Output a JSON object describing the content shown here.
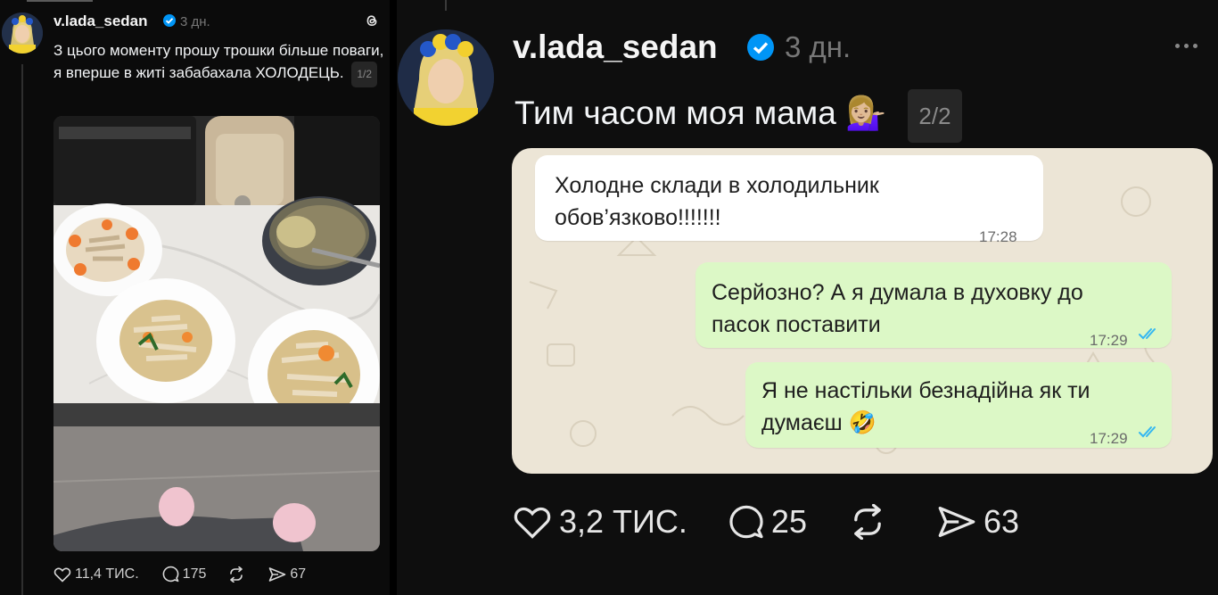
{
  "left_post": {
    "username": "v.lada_sedan",
    "time": "3 дн.",
    "text": "З цього моменту прошу трошки більше поваги, я вперше в житі забабахала ХОЛОДЕЦЬ.",
    "page_badge": "1/2",
    "actions": {
      "likes": "11,4 ТИС.",
      "comments": "175",
      "shares": "67"
    }
  },
  "right_post": {
    "username": "v.lada_sedan",
    "time": "3 дн.",
    "text": "Тим часом моя мама 💁🏼‍♀️",
    "page_badge": "2/2",
    "chat": {
      "messages": [
        {
          "direction": "incoming",
          "text_line1": "Холодне склади в холодильник",
          "text_line2": "обов’язково!!!!!!!",
          "time": "17:28"
        },
        {
          "direction": "outgoing",
          "text_line1": "Серйозно? А я думала в духовку до",
          "text_line2": "пасок поставити",
          "time": "17:29"
        },
        {
          "direction": "outgoing",
          "text_line1": "Я не настільки безнадійна як ти",
          "text_line2": "думаєш 🤣",
          "time": "17:29"
        }
      ]
    },
    "actions": {
      "likes": "3,2 ТИС.",
      "comments": "25",
      "shares": "63"
    }
  },
  "icons": [
    "threads-logo-icon",
    "verified-icon",
    "heart-icon",
    "comment-icon",
    "repost-icon",
    "share-icon",
    "more-icon",
    "read-receipt-icon"
  ],
  "colors": {
    "background": "#000000",
    "verified": "#0095f6",
    "bubble_in": "#ffffff",
    "bubble_out": "#dcf8c6",
    "read_ticks": "#34b7f1"
  }
}
